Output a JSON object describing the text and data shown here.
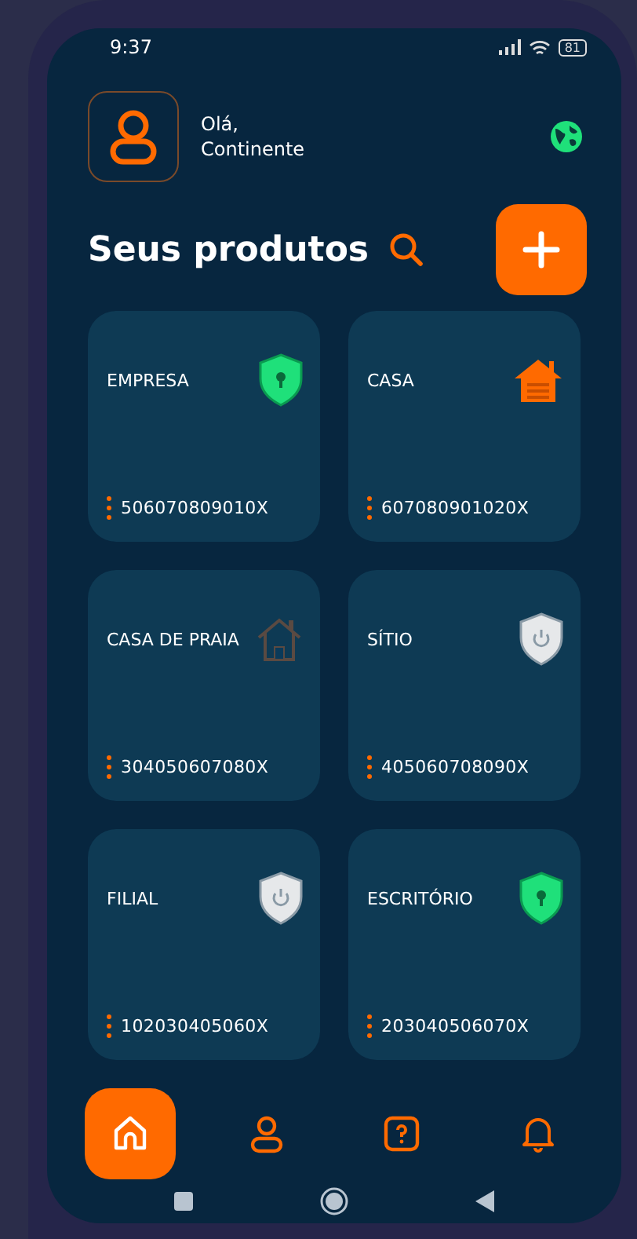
{
  "status_bar": {
    "time": "9:37",
    "battery": "81"
  },
  "header": {
    "greeting": "Olá,",
    "name": "Continente"
  },
  "section": {
    "title": "Seus produtos"
  },
  "products": [
    {
      "name": "EMPRESA",
      "serial": "506070809010X",
      "kind": "shield",
      "active": true
    },
    {
      "name": "CASA",
      "serial": "607080901020X",
      "kind": "house",
      "active": true
    },
    {
      "name": "CASA DE PRAIA",
      "serial": "304050607080X",
      "kind": "house",
      "active": false
    },
    {
      "name": "SÍTIO",
      "serial": "405060708090X",
      "kind": "shield",
      "active": false
    },
    {
      "name": "FILIAL",
      "serial": "102030405060X",
      "kind": "shield",
      "active": false
    },
    {
      "name": "ESCRITÓRIO",
      "serial": "203040506070X",
      "kind": "shield",
      "active": true
    }
  ],
  "nav": [
    {
      "kind": "home",
      "selected": true
    },
    {
      "kind": "profile",
      "selected": false
    },
    {
      "kind": "help",
      "selected": false
    },
    {
      "kind": "notifications",
      "selected": false
    }
  ]
}
